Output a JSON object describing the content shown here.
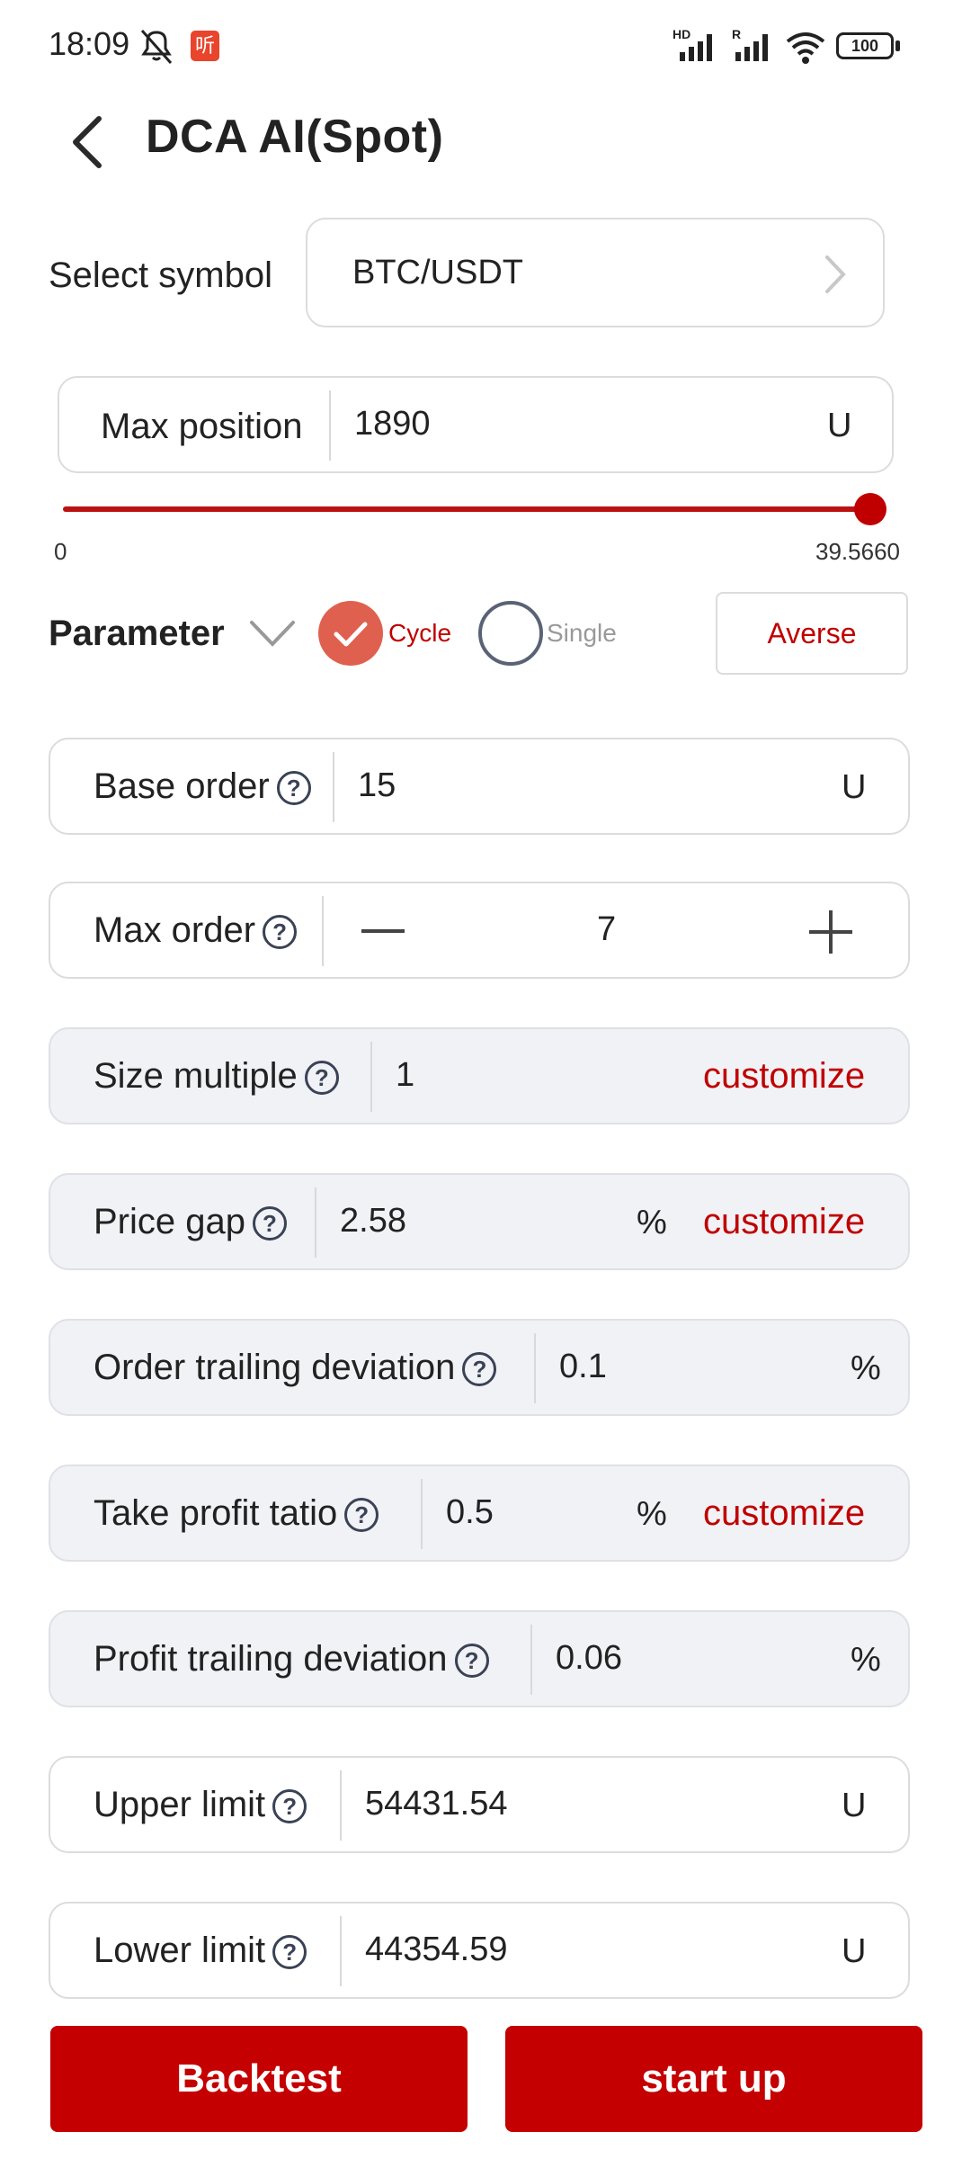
{
  "status_bar": {
    "time": "18:09",
    "app_badge": "听",
    "battery": "100",
    "hd_label": "HD",
    "r_label": "R"
  },
  "header": {
    "title": "DCA AI(Spot)"
  },
  "symbol": {
    "label": "Select symbol",
    "value": "BTC/USDT"
  },
  "max_position": {
    "label": "Max position",
    "value": "1890",
    "unit": "U",
    "slider_min": "0",
    "slider_max": "39.5660",
    "slider_level": 1.0
  },
  "parameter": {
    "label": "Parameter",
    "mode_cycle": "Cycle",
    "mode_single": "Single",
    "selected_mode": "Cycle",
    "averse_label": "Averse"
  },
  "fields": {
    "base_order": {
      "label": "Base order",
      "value": "15",
      "unit": "U"
    },
    "max_order": {
      "label": "Max order",
      "value": "7"
    },
    "size_multiple": {
      "label": "Size multiple",
      "value": "1",
      "action": "customize"
    },
    "price_gap": {
      "label": "Price gap",
      "value": "2.58",
      "unit": "%",
      "action": "customize"
    },
    "order_trailing": {
      "label": "Order trailing deviation",
      "value": "0.1",
      "unit": "%"
    },
    "take_profit": {
      "label": "Take profit tatio",
      "value": "0.5",
      "unit": "%",
      "action": "customize"
    },
    "profit_trailing": {
      "label": "Profit trailing deviation",
      "value": "0.06",
      "unit": "%"
    },
    "upper_limit": {
      "label": "Upper limit",
      "value": "54431.54",
      "unit": "U"
    },
    "lower_limit": {
      "label": "Lower limit",
      "value": "44354.59",
      "unit": "U"
    }
  },
  "footer": {
    "backtest_label": "Backtest",
    "start_label": "start up"
  },
  "colors": {
    "accent": "#c40000",
    "check": "#e06050"
  }
}
